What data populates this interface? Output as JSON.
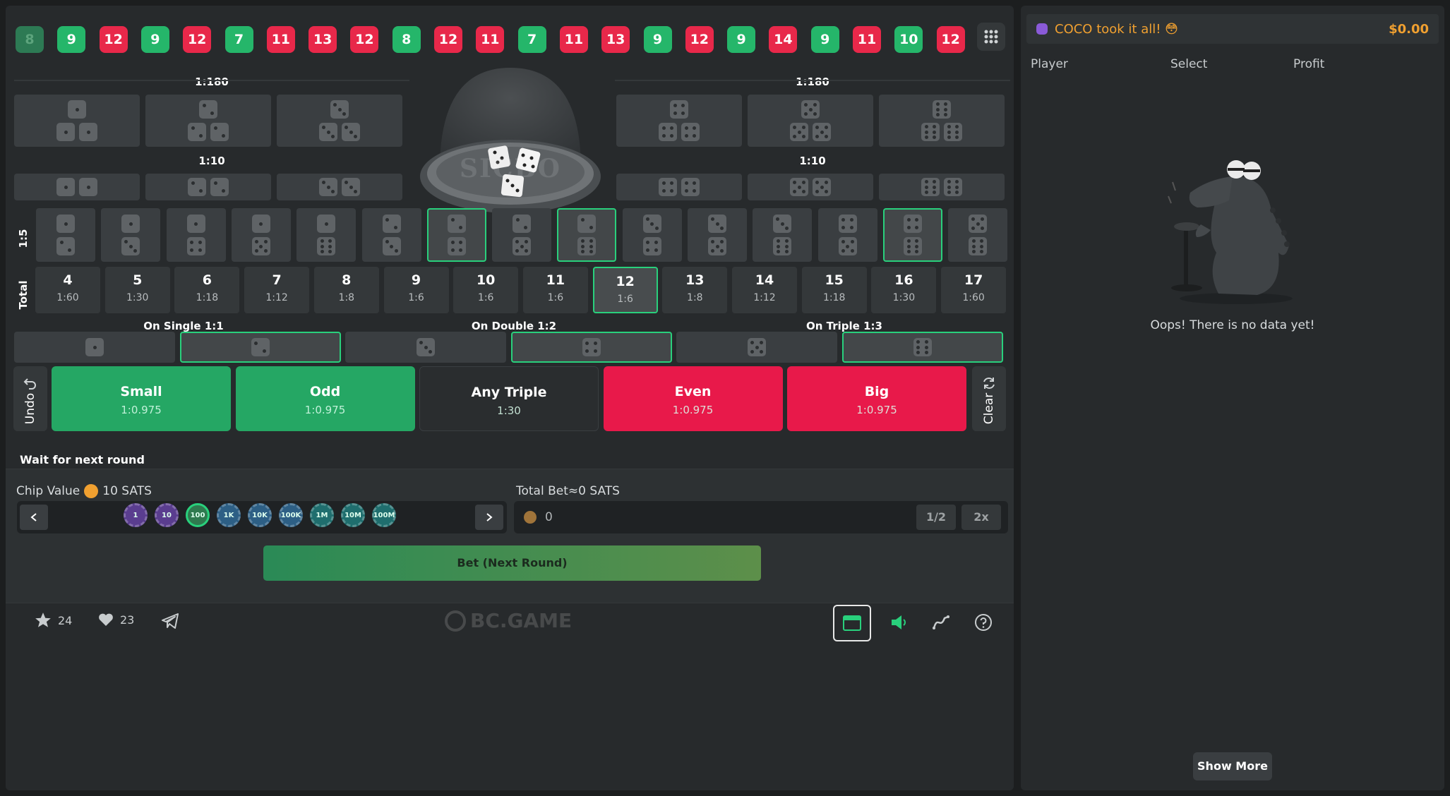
{
  "history": [
    {
      "v": "8",
      "c": "f"
    },
    {
      "v": "9",
      "c": "g"
    },
    {
      "v": "12",
      "c": "r"
    },
    {
      "v": "9",
      "c": "g"
    },
    {
      "v": "12",
      "c": "r"
    },
    {
      "v": "7",
      "c": "g"
    },
    {
      "v": "11",
      "c": "r"
    },
    {
      "v": "13",
      "c": "r"
    },
    {
      "v": "12",
      "c": "r"
    },
    {
      "v": "8",
      "c": "g"
    },
    {
      "v": "12",
      "c": "r"
    },
    {
      "v": "11",
      "c": "r"
    },
    {
      "v": "7",
      "c": "g"
    },
    {
      "v": "11",
      "c": "r"
    },
    {
      "v": "13",
      "c": "r"
    },
    {
      "v": "9",
      "c": "g"
    },
    {
      "v": "12",
      "c": "r"
    },
    {
      "v": "9",
      "c": "g"
    },
    {
      "v": "14",
      "c": "r"
    },
    {
      "v": "9",
      "c": "g"
    },
    {
      "v": "11",
      "c": "r"
    },
    {
      "v": "10",
      "c": "g"
    },
    {
      "v": "12",
      "c": "r"
    }
  ],
  "labels": {
    "odds_180_left": "1:180",
    "odds_180_right": "1:180",
    "odds_10_left": "1:10",
    "odds_10_right": "1:10",
    "odds_5": "1:5",
    "total": "Total",
    "on_single": "On Single 1:1",
    "on_double": "On Double 1:2",
    "on_triple": "On Triple 1:3",
    "undo": "Undo",
    "clear": "Clear",
    "wait": "Wait for next round"
  },
  "bowl_text": "SICBO",
  "totals": [
    {
      "n": "4",
      "o": "1:60"
    },
    {
      "n": "5",
      "o": "1:30"
    },
    {
      "n": "6",
      "o": "1:18"
    },
    {
      "n": "7",
      "o": "1:12"
    },
    {
      "n": "8",
      "o": "1:8"
    },
    {
      "n": "9",
      "o": "1:6"
    },
    {
      "n": "10",
      "o": "1:6"
    },
    {
      "n": "11",
      "o": "1:6"
    },
    {
      "n": "12",
      "o": "1:6"
    },
    {
      "n": "13",
      "o": "1:8"
    },
    {
      "n": "14",
      "o": "1:12"
    },
    {
      "n": "15",
      "o": "1:18"
    },
    {
      "n": "16",
      "o": "1:30"
    },
    {
      "n": "17",
      "o": "1:60"
    }
  ],
  "big_bets": [
    {
      "t": "Small",
      "s": "1:0.975",
      "color": "#25a764"
    },
    {
      "t": "Odd",
      "s": "1:0.975",
      "color": "#25a764"
    },
    {
      "t": "Any Triple",
      "s": "1:30",
      "color": "#2a2d2f"
    },
    {
      "t": "Even",
      "s": "1:0.975",
      "color": "#e8194a"
    },
    {
      "t": "Big",
      "s": "1:0.975",
      "color": "#e8194a"
    }
  ],
  "chip": {
    "label": "Chip Value",
    "value": "10 SATS",
    "chips": [
      "1",
      "10",
      "100",
      "1K",
      "10K",
      "100K",
      "1M",
      "10M",
      "100M"
    ]
  },
  "total_bet": {
    "label": "Total Bet≈0 SATS",
    "amount": "0",
    "half": "1/2",
    "double": "2x"
  },
  "bet_button": "Bet (Next Round)",
  "footer": {
    "stars": "24",
    "likes": "23",
    "logo": "BC.GAME"
  },
  "side": {
    "banner": "COCO took it all! 😳",
    "amount": "$0.00",
    "cols": [
      "Player",
      "Select",
      "Profit"
    ],
    "empty": "Oops! There is no data yet!",
    "show_more": "Show More"
  },
  "colors": {
    "green": "#25b66a",
    "red": "#e8284a",
    "accent": "#29d07c",
    "orange": "#f0a030"
  }
}
